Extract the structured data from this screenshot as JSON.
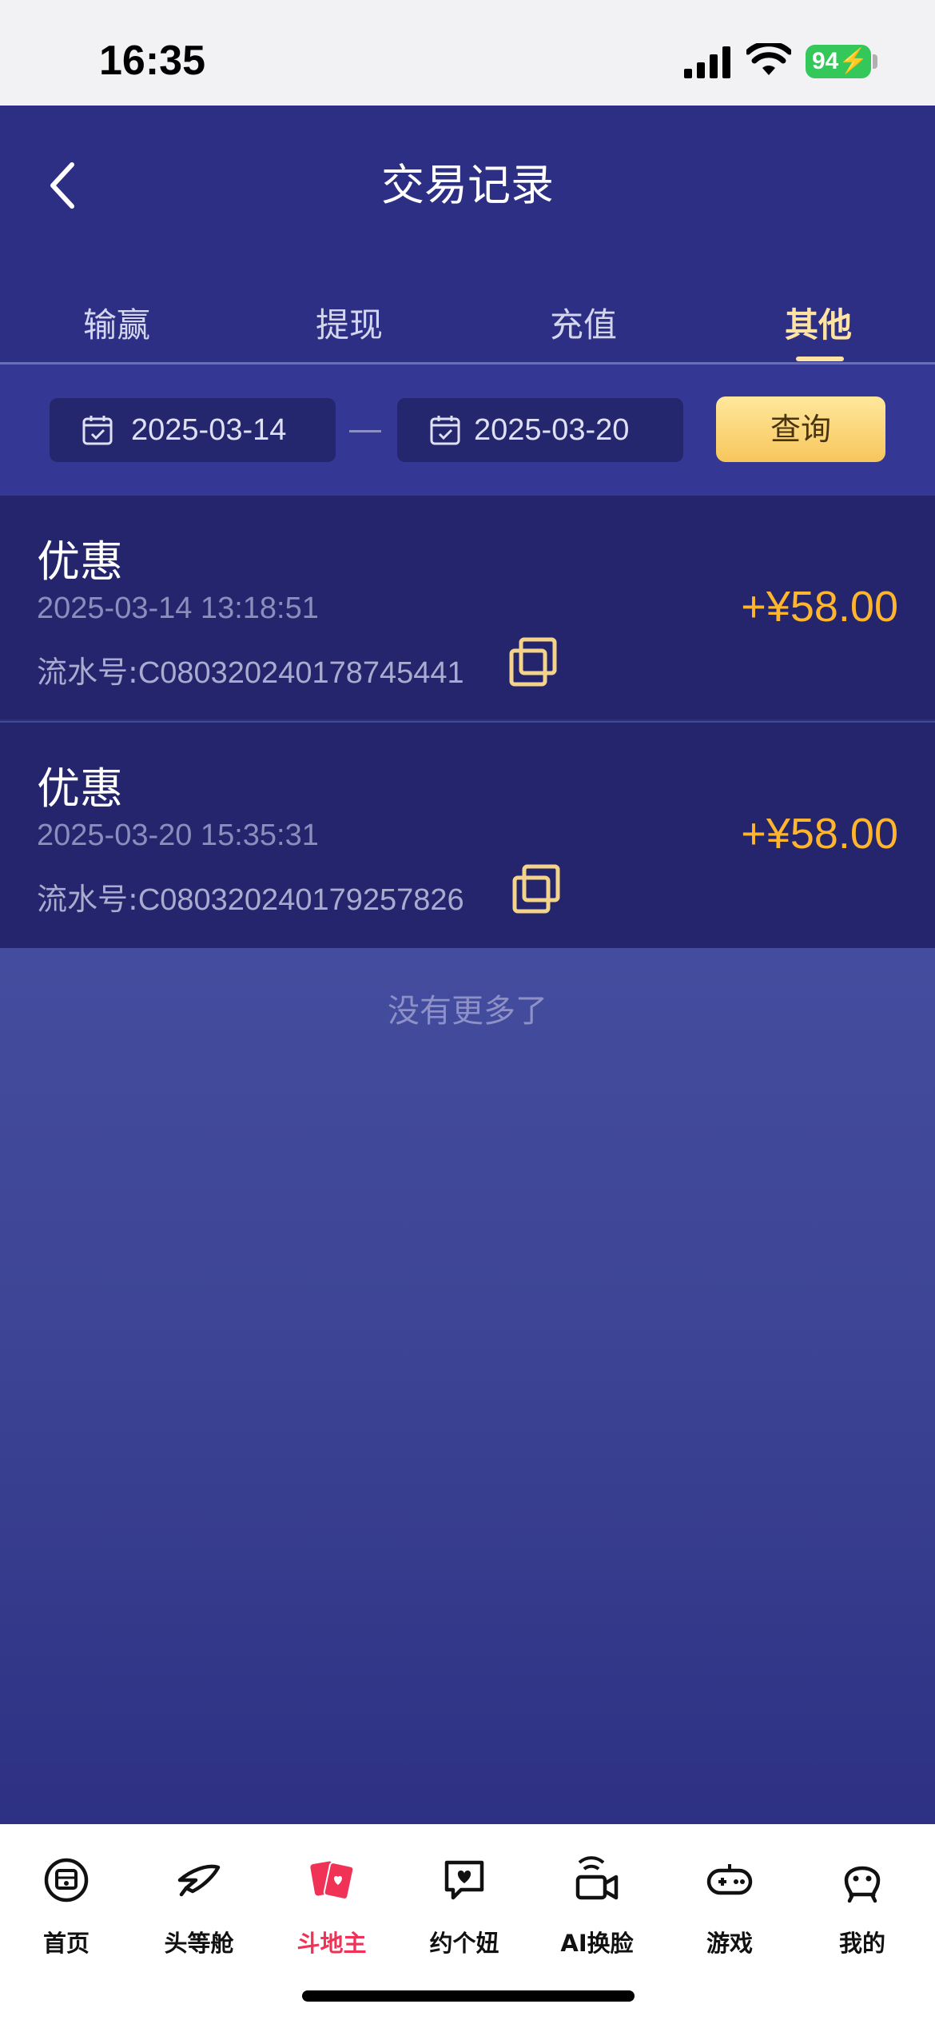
{
  "status_bar": {
    "time": "16:35",
    "battery": "94"
  },
  "header": {
    "title": "交易记录"
  },
  "tabs": [
    {
      "label": "输赢",
      "active": false
    },
    {
      "label": "提现",
      "active": false
    },
    {
      "label": "充值",
      "active": false
    },
    {
      "label": "其他",
      "active": true
    }
  ],
  "filter": {
    "start_date": "2025-03-14",
    "end_date": "2025-03-20",
    "query_label": "查询"
  },
  "records": [
    {
      "title": "优惠",
      "time": "2025-03-14 13:18:51",
      "serial_prefix": "流水号:",
      "serial": "C080320240178745441",
      "amount": "+¥58.00"
    },
    {
      "title": "优惠",
      "time": "2025-03-20 15:35:31",
      "serial_prefix": "流水号:",
      "serial": "C080320240179257826",
      "amount": "+¥58.00"
    }
  ],
  "footer_note": "没有更多了",
  "bottom_nav": [
    {
      "label": "首页",
      "icon": "home-icon"
    },
    {
      "label": "头等舱",
      "icon": "plane-icon"
    },
    {
      "label": "斗地主",
      "icon": "cards-icon",
      "active": true
    },
    {
      "label": "约个妞",
      "icon": "heart-chat-icon"
    },
    {
      "label": "AI换脸",
      "icon": "video-camera-icon"
    },
    {
      "label": "游戏",
      "icon": "gamepad-icon"
    },
    {
      "label": "我的",
      "icon": "user-icon"
    }
  ],
  "colors": {
    "accent": "#ffb52e",
    "tab_active": "#ffe3a3",
    "nav_active": "#ef3256",
    "background": "#2c2f84"
  }
}
